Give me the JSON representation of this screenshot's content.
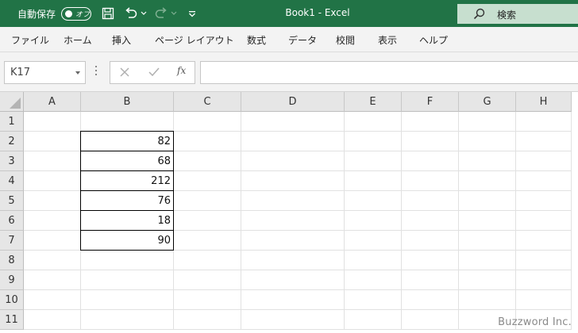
{
  "titlebar": {
    "autosave_label": "自動保存",
    "toggle_text": "オフ",
    "document_title": "Book1  -  Excel",
    "search_text": "検索"
  },
  "menu": [
    {
      "id": "file",
      "label": "ファイル"
    },
    {
      "id": "home",
      "label": "ホーム"
    },
    {
      "id": "insert",
      "label": "挿入"
    },
    {
      "id": "page-layout",
      "label": "ページ レイアウト"
    },
    {
      "id": "formulas",
      "label": "数式"
    },
    {
      "id": "data",
      "label": "データ"
    },
    {
      "id": "review",
      "label": "校閲"
    },
    {
      "id": "view",
      "label": "表示"
    },
    {
      "id": "help",
      "label": "ヘルプ"
    }
  ],
  "formulabar": {
    "namebox_value": "K17",
    "fx_label": "fx",
    "formula_value": ""
  },
  "columns": [
    "A",
    "B",
    "C",
    "D",
    "E",
    "F",
    "G",
    "H"
  ],
  "rows": [
    "1",
    "2",
    "3",
    "4",
    "5",
    "6",
    "7",
    "8",
    "9",
    "10",
    "11"
  ],
  "cells": {
    "B2": "82",
    "B3": "68",
    "B4": "212",
    "B5": "76",
    "B6": "18",
    "B7": "90"
  },
  "watermark": "Buzzword Inc."
}
